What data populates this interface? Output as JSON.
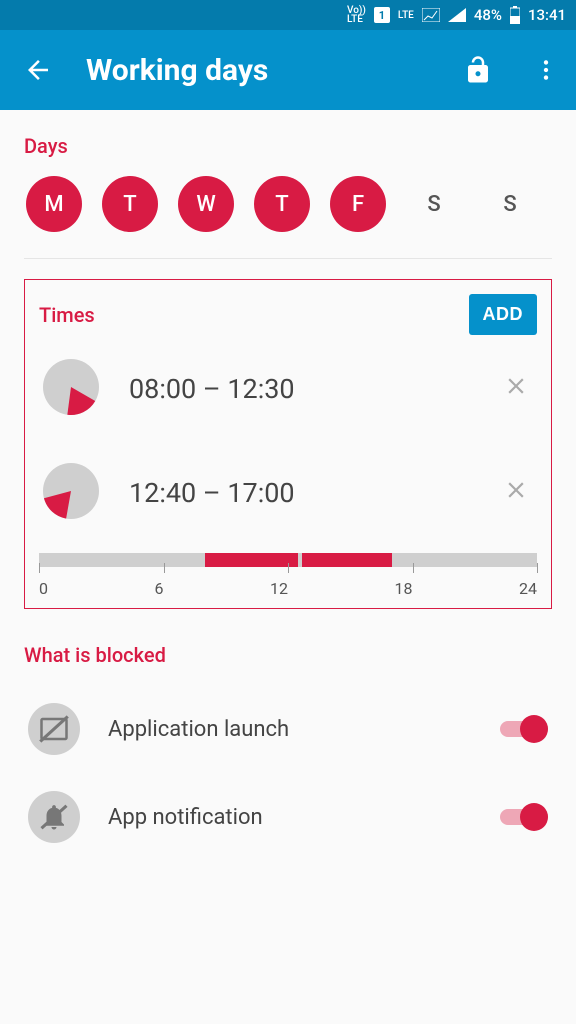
{
  "statusbar": {
    "volte": "Vo))\nLTE",
    "sim": "1",
    "lte": "LTE",
    "battery": "48%",
    "time": "13:41"
  },
  "appbar": {
    "title": "Working days"
  },
  "days": {
    "title": "Days",
    "items": [
      {
        "label": "M",
        "selected": true
      },
      {
        "label": "T",
        "selected": true
      },
      {
        "label": "W",
        "selected": true
      },
      {
        "label": "T",
        "selected": true
      },
      {
        "label": "F",
        "selected": true
      },
      {
        "label": "S",
        "selected": false
      },
      {
        "label": "S",
        "selected": false
      }
    ]
  },
  "times": {
    "title": "Times",
    "add_label": "ADD",
    "ranges": [
      {
        "label": "08:00 – 12:30",
        "start": 8.0,
        "end": 12.5
      },
      {
        "label": "12:40 – 17:00",
        "start": 12.67,
        "end": 17.0
      }
    ],
    "axis": [
      "0",
      "6",
      "12",
      "18",
      "24"
    ]
  },
  "blocked": {
    "title": "What is blocked",
    "items": [
      {
        "label": "Application launch",
        "on": true,
        "icon": "app-launch"
      },
      {
        "label": "App notification",
        "on": true,
        "icon": "bell-off"
      }
    ]
  }
}
